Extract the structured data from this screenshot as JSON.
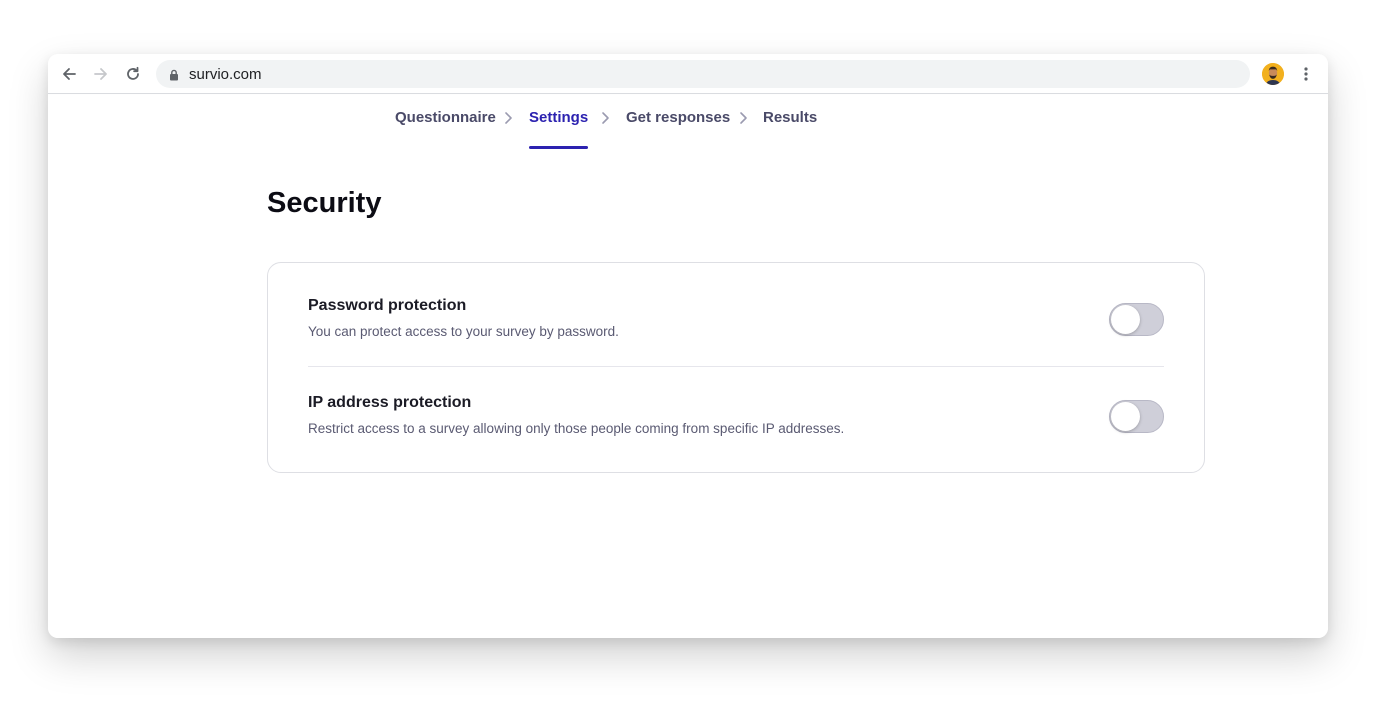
{
  "browser": {
    "url": "survio.com"
  },
  "steps": [
    {
      "label": "Questionnaire",
      "active": false
    },
    {
      "label": "Settings",
      "active": true
    },
    {
      "label": "Get responses",
      "active": false
    },
    {
      "label": "Results",
      "active": false
    }
  ],
  "page": {
    "title": "Security"
  },
  "settings": [
    {
      "title": "Password protection",
      "description": "You can protect access to your survey by password.",
      "enabled": false
    },
    {
      "title": "IP address protection",
      "description": "Restrict access to a survey allowing only those people coming from specific IP addresses.",
      "enabled": false
    }
  ],
  "colors": {
    "accent": "#2c22b0",
    "toggle_off": "#cfcfd9"
  }
}
